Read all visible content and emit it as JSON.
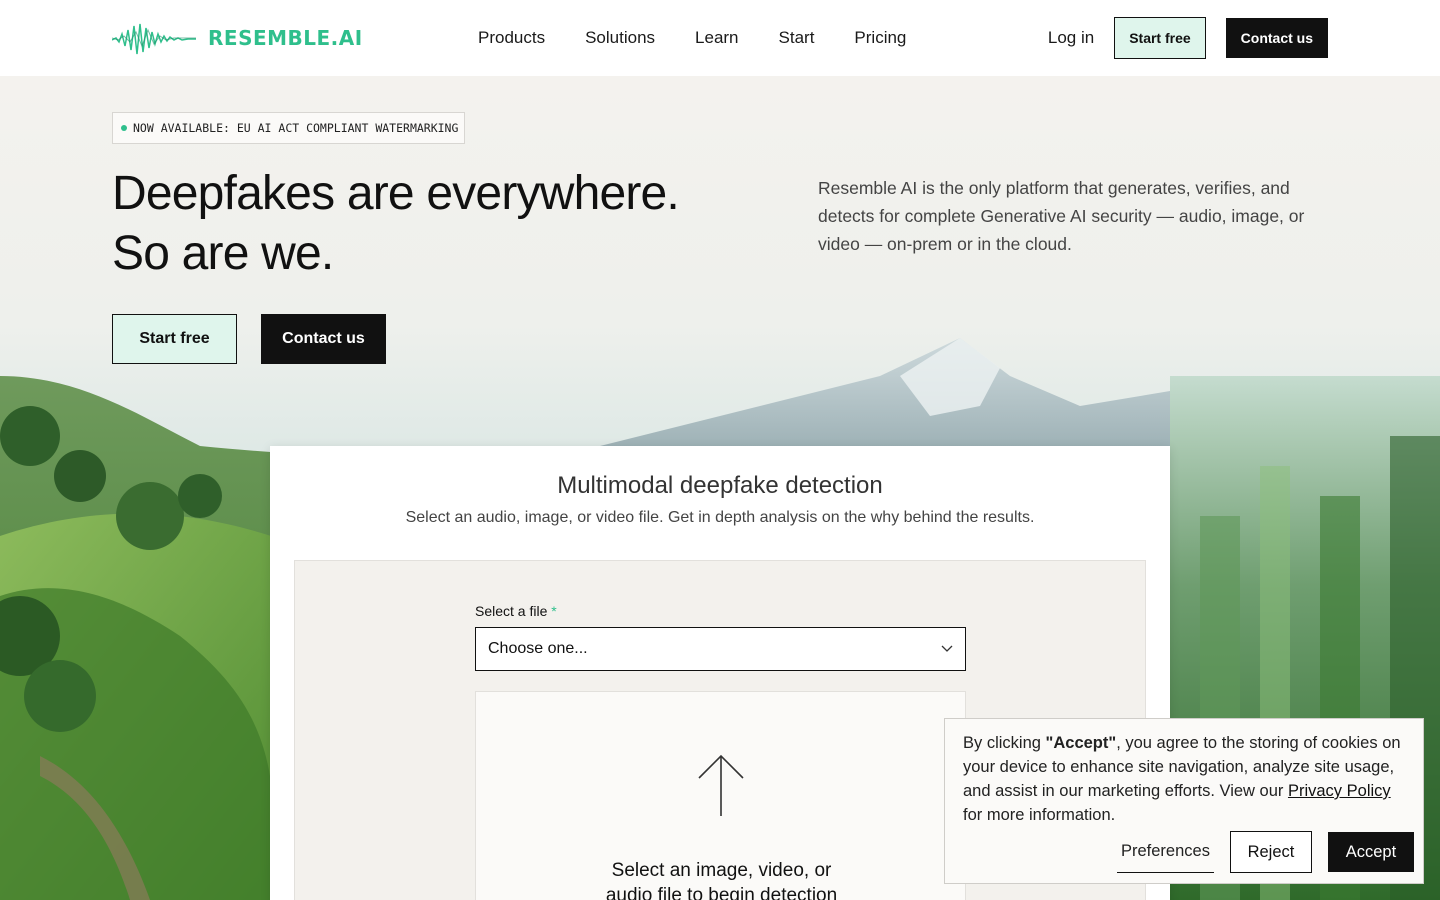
{
  "nav": {
    "logo_text": "RESEMBLE.AI",
    "links": [
      "Products",
      "Solutions",
      "Learn",
      "Start",
      "Pricing"
    ],
    "login": "Log in",
    "start_free": "Start free",
    "contact": "Contact us"
  },
  "hero": {
    "badge": "NOW AVAILABLE: EU AI ACT COMPLIANT WATERMARKING",
    "title_line1": "Deepfakes are everywhere.",
    "title_line2": "So are we.",
    "description": "Resemble AI is the only platform that generates, verifies, and detects for complete Generative AI security — audio, image, or video — on-prem or in the cloud.",
    "start_free": "Start free",
    "contact": "Contact us"
  },
  "detection": {
    "title": "Multimodal deepfake detection",
    "subtitle": "Select an audio, image, or video file. Get in depth analysis on the why behind the results.",
    "field_label": "Select a file",
    "required_mark": "*",
    "select_value": "Choose one...",
    "drop_line1": "Select an image, video, or",
    "drop_line2": "audio file to begin detection"
  },
  "cookie": {
    "text_before": "By clicking ",
    "accept_quote": "\"Accept\"",
    "text_middle": ", you agree to the storing of cookies on your device to enhance site navigation, analyze site usage, and assist in our marketing efforts. View our ",
    "policy_link": "Privacy Policy",
    "text_after": " for more information.",
    "preferences": "Preferences",
    "reject": "Reject",
    "accept": "Accept"
  },
  "colors": {
    "brand_green": "#2fbf8c",
    "button_light": "#dff5ec",
    "dark": "#111111"
  },
  "icons": [
    "sound-wave-logo-icon",
    "chevron-down-icon",
    "upload-arrow-icon"
  ]
}
